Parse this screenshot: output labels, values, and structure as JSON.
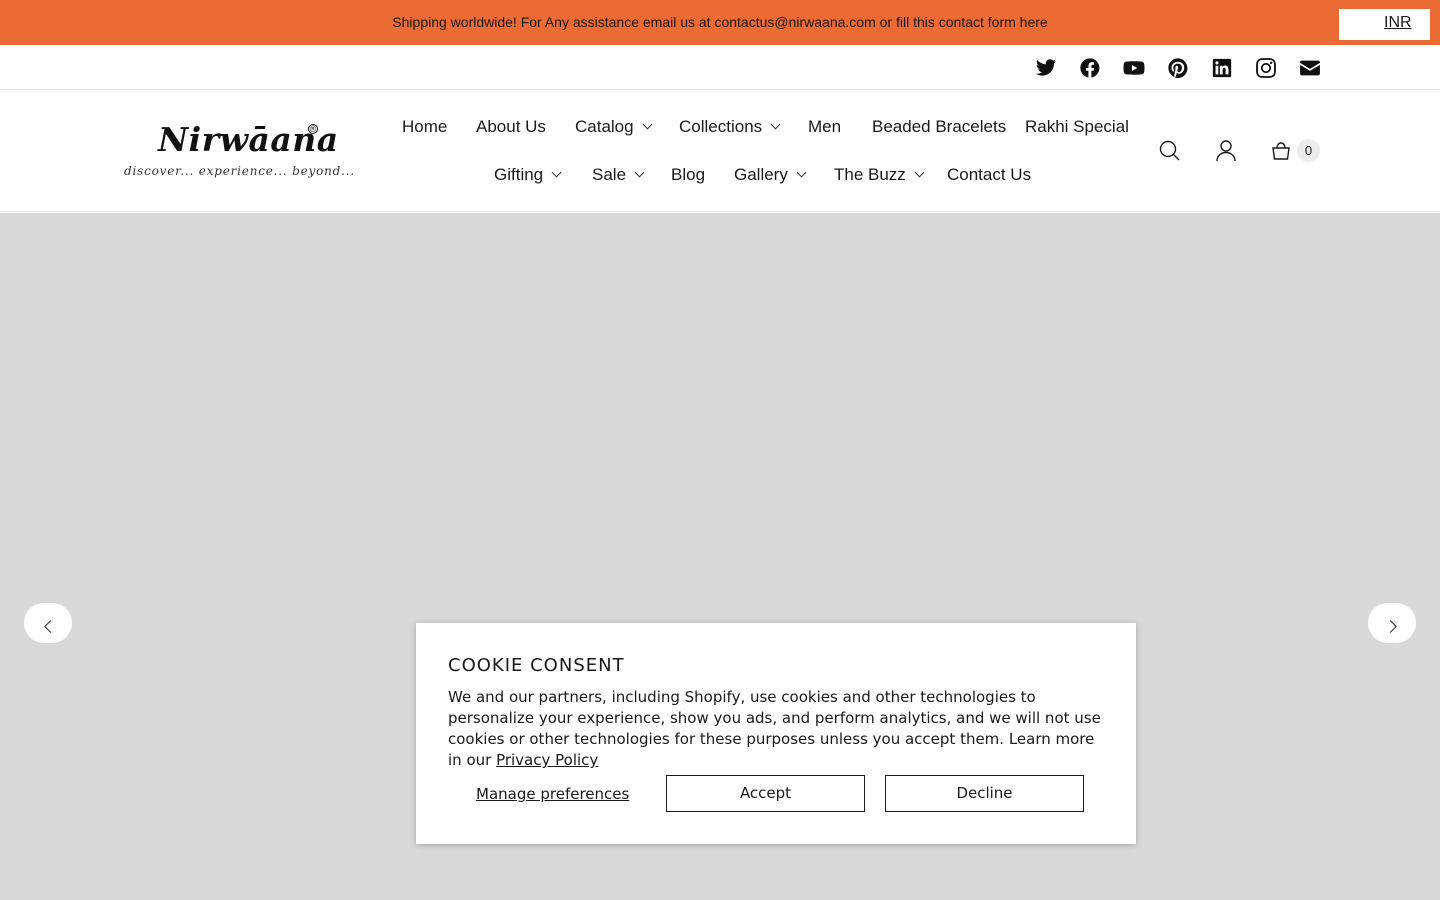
{
  "announcement": {
    "text": "Shipping worldwide! For Any assistance email us at contactus@nirwaana.com or fill this contact form here",
    "currency": "INR"
  },
  "social": [
    "twitter-icon",
    "facebook-icon",
    "youtube-icon",
    "pinterest-icon",
    "linkedin-icon",
    "instagram-icon",
    "email-icon"
  ],
  "logo": {
    "wordmark": "Nirwāana",
    "tagline": "discover... experience... beyond...",
    "registered": "®"
  },
  "nav": {
    "row1": [
      "Home",
      "About Us",
      "Catalog",
      "Collections",
      "Men",
      "Beaded Bracelets",
      "Rakhi Special"
    ],
    "row2": [
      "Gifting",
      "Sale",
      "Blog",
      "Gallery",
      "The Buzz",
      "Contact Us"
    ]
  },
  "header_icons": {
    "search": "search-icon",
    "account": "account-icon",
    "cart": "cart-icon",
    "cart_count": "0"
  },
  "cookie": {
    "title": "COOKIE CONSENT",
    "text": "We and our partners, including Shopify, use cookies and other technologies to personalize your experience, show you ads, and perform analytics, and we will not use cookies or other technologies for these purposes unless you accept them. Learn more in our ",
    "privacy_link": "Privacy Policy",
    "manage_label": "Manage preferences",
    "accept_label": "Accept",
    "decline_label": "Decline"
  },
  "colors": {
    "announcement_bg": "#ec6a33",
    "slideshow_bg": "#d9d9d9"
  }
}
